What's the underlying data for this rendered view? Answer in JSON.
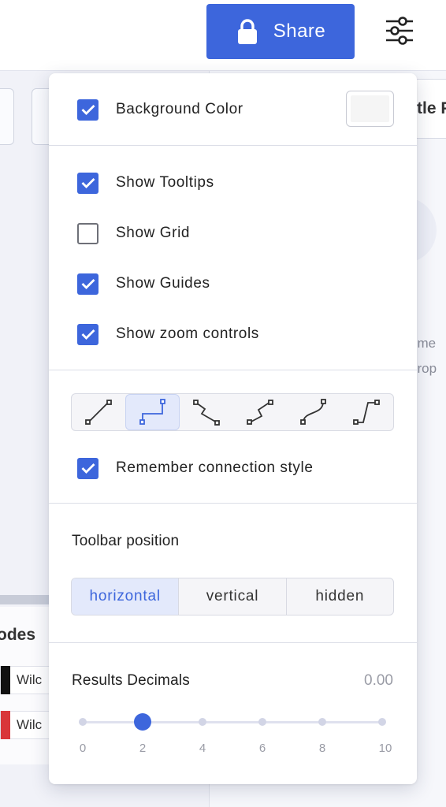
{
  "topbar": {
    "share_label": "Share"
  },
  "background": {
    "tab_fragment": "tle P",
    "text_fragment_1": "eme",
    "text_fragment_2": "prop",
    "nodes_title": "odes",
    "node_item_1": "Wilc",
    "node_item_2": "Wilc"
  },
  "settings": {
    "background_color": {
      "label": "Background Color",
      "checked": true,
      "swatch_color": "#f5f5f5"
    },
    "show_tooltips": {
      "label": "Show Tooltips",
      "checked": true
    },
    "show_grid": {
      "label": "Show Grid",
      "checked": false
    },
    "show_guides": {
      "label": "Show Guides",
      "checked": true
    },
    "show_zoom_controls": {
      "label": "Show zoom controls",
      "checked": true
    },
    "connection_styles": [
      "straight-connector-icon",
      "orthogonal-connector-icon",
      "zigzag-connector-icon",
      "step-connector-icon",
      "curved-connector-icon",
      "s-curve-connector-icon"
    ],
    "active_connection_style": "orthogonal-connector-icon",
    "remember_connection_style": {
      "label": "Remember connection style",
      "checked": true
    },
    "toolbar_position": {
      "label": "Toolbar position",
      "options": [
        "horizontal",
        "vertical",
        "hidden"
      ],
      "selected": "horizontal"
    },
    "results_decimals": {
      "label": "Results Decimals",
      "value_display": "0.00",
      "ticks": [
        "0",
        "2",
        "4",
        "6",
        "8",
        "10"
      ],
      "value": 2
    }
  },
  "colors": {
    "accent": "#3d66dc",
    "active_bg": "#e3e9fb"
  }
}
